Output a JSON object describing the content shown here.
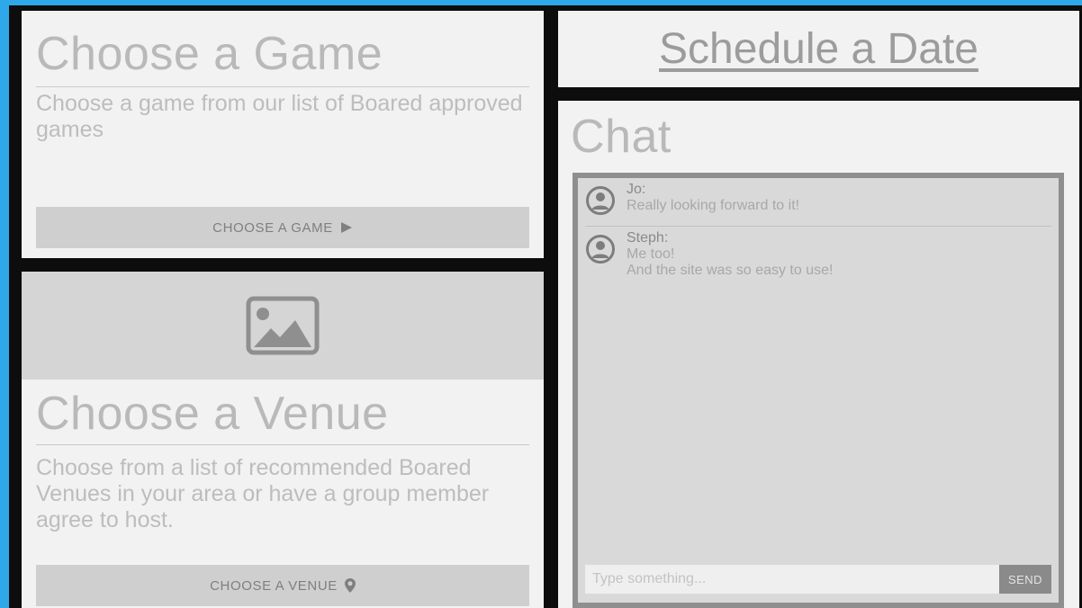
{
  "game_card": {
    "title": "Choose a Game",
    "description": "Choose a game from our list of Boared approved games",
    "button_label": "CHOOSE A GAME",
    "button_icon": "play-arrow-icon"
  },
  "venue_card": {
    "image_icon": "image-placeholder-icon",
    "title": "Choose a Venue",
    "description": "Choose from a list of recommended Boared Venues in your area or have a group member agree to host.",
    "button_label": "CHOOSE A VENUE",
    "button_icon": "location-pin-icon"
  },
  "schedule": {
    "link_text": "Schedule a Date"
  },
  "chat": {
    "title": "Chat",
    "messages": [
      {
        "author": "Jo:",
        "lines": [
          "Really looking forward to it!"
        ]
      },
      {
        "author": "Steph:",
        "lines": [
          "Me too!",
          "And the site was so easy to use!"
        ]
      }
    ],
    "input_placeholder": "Type something...",
    "input_value": "",
    "send_label": "SEND"
  },
  "colors": {
    "window_border": "#2ea8e8",
    "page_gutter": "#0d0d0d",
    "card_background": "#f2f2f2",
    "muted_text": "#b9b9b9",
    "button_background": "#cfcfcf",
    "send_button": "#8a8a8a"
  }
}
